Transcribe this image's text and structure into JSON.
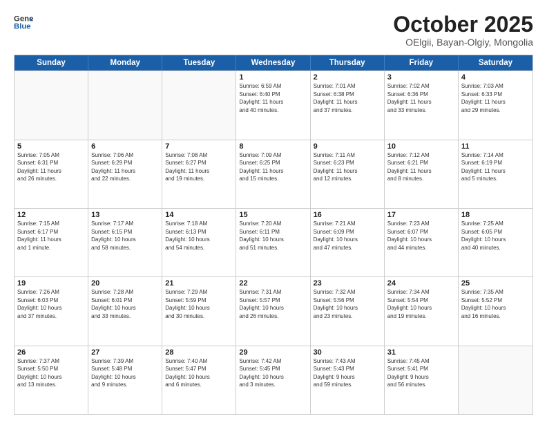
{
  "header": {
    "logo_line1": "General",
    "logo_line2": "Blue",
    "title": "October 2025",
    "subtitle": "OElgii, Bayan-Olgiy, Mongolia"
  },
  "weekdays": [
    "Sunday",
    "Monday",
    "Tuesday",
    "Wednesday",
    "Thursday",
    "Friday",
    "Saturday"
  ],
  "rows": [
    [
      {
        "day": "",
        "info": ""
      },
      {
        "day": "",
        "info": ""
      },
      {
        "day": "",
        "info": ""
      },
      {
        "day": "1",
        "info": "Sunrise: 6:59 AM\nSunset: 6:40 PM\nDaylight: 11 hours\nand 40 minutes."
      },
      {
        "day": "2",
        "info": "Sunrise: 7:01 AM\nSunset: 6:38 PM\nDaylight: 11 hours\nand 37 minutes."
      },
      {
        "day": "3",
        "info": "Sunrise: 7:02 AM\nSunset: 6:36 PM\nDaylight: 11 hours\nand 33 minutes."
      },
      {
        "day": "4",
        "info": "Sunrise: 7:03 AM\nSunset: 6:33 PM\nDaylight: 11 hours\nand 29 minutes."
      }
    ],
    [
      {
        "day": "5",
        "info": "Sunrise: 7:05 AM\nSunset: 6:31 PM\nDaylight: 11 hours\nand 26 minutes."
      },
      {
        "day": "6",
        "info": "Sunrise: 7:06 AM\nSunset: 6:29 PM\nDaylight: 11 hours\nand 22 minutes."
      },
      {
        "day": "7",
        "info": "Sunrise: 7:08 AM\nSunset: 6:27 PM\nDaylight: 11 hours\nand 19 minutes."
      },
      {
        "day": "8",
        "info": "Sunrise: 7:09 AM\nSunset: 6:25 PM\nDaylight: 11 hours\nand 15 minutes."
      },
      {
        "day": "9",
        "info": "Sunrise: 7:11 AM\nSunset: 6:23 PM\nDaylight: 11 hours\nand 12 minutes."
      },
      {
        "day": "10",
        "info": "Sunrise: 7:12 AM\nSunset: 6:21 PM\nDaylight: 11 hours\nand 8 minutes."
      },
      {
        "day": "11",
        "info": "Sunrise: 7:14 AM\nSunset: 6:19 PM\nDaylight: 11 hours\nand 5 minutes."
      }
    ],
    [
      {
        "day": "12",
        "info": "Sunrise: 7:15 AM\nSunset: 6:17 PM\nDaylight: 11 hours\nand 1 minute."
      },
      {
        "day": "13",
        "info": "Sunrise: 7:17 AM\nSunset: 6:15 PM\nDaylight: 10 hours\nand 58 minutes."
      },
      {
        "day": "14",
        "info": "Sunrise: 7:18 AM\nSunset: 6:13 PM\nDaylight: 10 hours\nand 54 minutes."
      },
      {
        "day": "15",
        "info": "Sunrise: 7:20 AM\nSunset: 6:11 PM\nDaylight: 10 hours\nand 51 minutes."
      },
      {
        "day": "16",
        "info": "Sunrise: 7:21 AM\nSunset: 6:09 PM\nDaylight: 10 hours\nand 47 minutes."
      },
      {
        "day": "17",
        "info": "Sunrise: 7:23 AM\nSunset: 6:07 PM\nDaylight: 10 hours\nand 44 minutes."
      },
      {
        "day": "18",
        "info": "Sunrise: 7:25 AM\nSunset: 6:05 PM\nDaylight: 10 hours\nand 40 minutes."
      }
    ],
    [
      {
        "day": "19",
        "info": "Sunrise: 7:26 AM\nSunset: 6:03 PM\nDaylight: 10 hours\nand 37 minutes."
      },
      {
        "day": "20",
        "info": "Sunrise: 7:28 AM\nSunset: 6:01 PM\nDaylight: 10 hours\nand 33 minutes."
      },
      {
        "day": "21",
        "info": "Sunrise: 7:29 AM\nSunset: 5:59 PM\nDaylight: 10 hours\nand 30 minutes."
      },
      {
        "day": "22",
        "info": "Sunrise: 7:31 AM\nSunset: 5:57 PM\nDaylight: 10 hours\nand 26 minutes."
      },
      {
        "day": "23",
        "info": "Sunrise: 7:32 AM\nSunset: 5:56 PM\nDaylight: 10 hours\nand 23 minutes."
      },
      {
        "day": "24",
        "info": "Sunrise: 7:34 AM\nSunset: 5:54 PM\nDaylight: 10 hours\nand 19 minutes."
      },
      {
        "day": "25",
        "info": "Sunrise: 7:35 AM\nSunset: 5:52 PM\nDaylight: 10 hours\nand 16 minutes."
      }
    ],
    [
      {
        "day": "26",
        "info": "Sunrise: 7:37 AM\nSunset: 5:50 PM\nDaylight: 10 hours\nand 13 minutes."
      },
      {
        "day": "27",
        "info": "Sunrise: 7:39 AM\nSunset: 5:48 PM\nDaylight: 10 hours\nand 9 minutes."
      },
      {
        "day": "28",
        "info": "Sunrise: 7:40 AM\nSunset: 5:47 PM\nDaylight: 10 hours\nand 6 minutes."
      },
      {
        "day": "29",
        "info": "Sunrise: 7:42 AM\nSunset: 5:45 PM\nDaylight: 10 hours\nand 3 minutes."
      },
      {
        "day": "30",
        "info": "Sunrise: 7:43 AM\nSunset: 5:43 PM\nDaylight: 9 hours\nand 59 minutes."
      },
      {
        "day": "31",
        "info": "Sunrise: 7:45 AM\nSunset: 5:41 PM\nDaylight: 9 hours\nand 56 minutes."
      },
      {
        "day": "",
        "info": ""
      }
    ]
  ]
}
